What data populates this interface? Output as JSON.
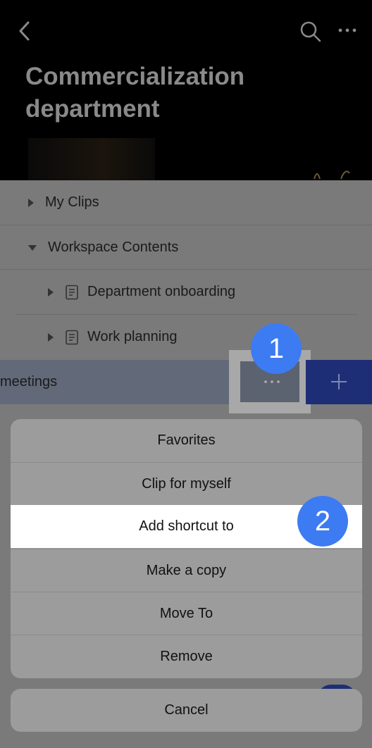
{
  "header": {
    "title": "Commercialization department",
    "back_icon": "chevron-left-icon",
    "search_icon": "search-icon",
    "more_icon": "more-horizontal-icon"
  },
  "tree": {
    "my_clips": "My Clips",
    "workspace_contents": "Workspace Contents",
    "department_onboarding": "Department onboarding",
    "work_planning": "Work planning",
    "meetings": "meetings"
  },
  "badges": {
    "step1": "1",
    "step2": "2"
  },
  "action_sheet": {
    "items": [
      "Favorites",
      "Clip for myself",
      "Add shortcut to",
      "Make a copy",
      "Move To",
      "Remove"
    ],
    "highlighted": "Add shortcut to",
    "cancel": "Cancel"
  },
  "colors": {
    "badge": "#3d7bf2",
    "add_button": "#1e2e76",
    "header": "#000000",
    "highlight": "#ffffff"
  }
}
